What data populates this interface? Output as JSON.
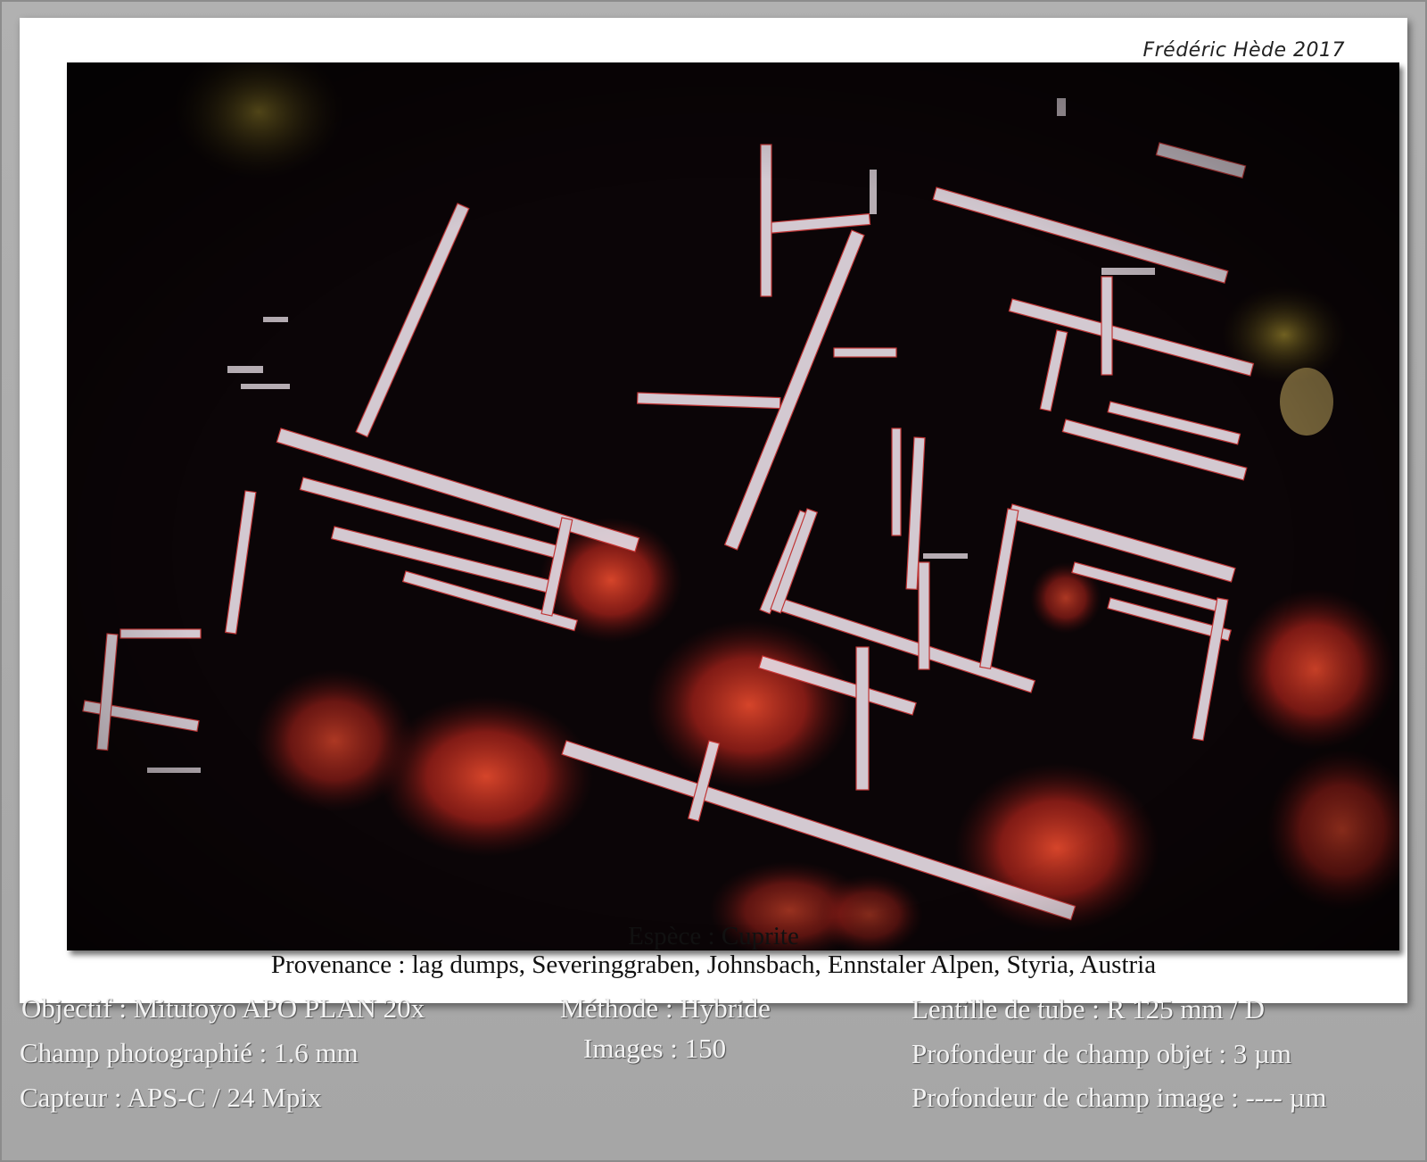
{
  "signature": "Frédéric Hède 2017",
  "caption": {
    "species": "Espèce : Cuprite",
    "origin": "Provenance : lag dumps, Severinggraben, Johnsbach, Ennstaler Alpen, Styria, Austria"
  },
  "specs": {
    "objective": "Objectif : Mitutoyo APO PLAN 20x",
    "field": "Champ photographié : 1.6 mm",
    "sensor": "Capteur : APS-C / 24 Mpix",
    "method": "Méthode : Hybride",
    "images": "Images : 150",
    "tube_lens": "Lentille de tube : R 125 mm / D",
    "object_dof": "Profondeur de champ objet : 3 µm",
    "image_dof": "Profondeur de champ image : ---- µm"
  },
  "colors": {
    "background": "#a9a9a9",
    "card": "#ffffff",
    "photo_background": "#070405",
    "crystal": "#e6dbe4",
    "cuprite_red": "#c8281c"
  }
}
